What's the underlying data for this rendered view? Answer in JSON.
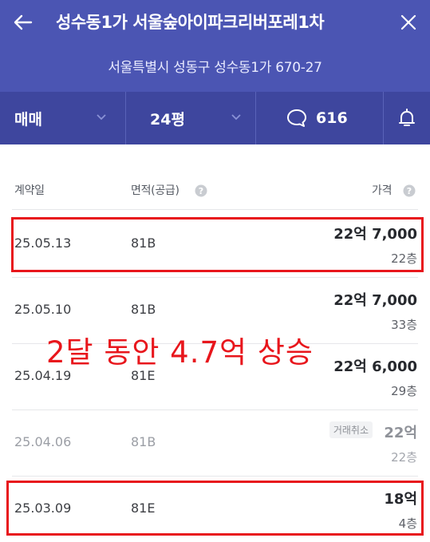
{
  "header": {
    "title": "성수동1가 서울숲아이파크리버포레1차",
    "address": "서울특별시 성동구 성수동1가 670-27",
    "icons": {
      "back": "arrow-left-icon",
      "close": "close-icon"
    },
    "bg_color": "#4b55b3"
  },
  "filters": {
    "deal_type": "매매",
    "size": "24평",
    "comment_count": "616",
    "icons": {
      "comment": "speech-bubble-icon",
      "alarm": "bell-icon"
    }
  },
  "table": {
    "columns": {
      "date": "계약일",
      "area": "면적(공급)",
      "price": "가격"
    },
    "rows": [
      {
        "date": "25.05.13",
        "area": "81B",
        "price": "22억 7,000",
        "floor": "22층",
        "cancelled": false,
        "highlighted": true
      },
      {
        "date": "25.05.10",
        "area": "81B",
        "price": "22억 7,000",
        "floor": "33층",
        "cancelled": false,
        "highlighted": false
      },
      {
        "date": "25.04.19",
        "area": "81E",
        "price": "22억 6,000",
        "floor": "29층",
        "cancelled": false,
        "highlighted": false
      },
      {
        "date": "25.04.06",
        "area": "81B",
        "price": "22억",
        "floor": "22층",
        "cancelled": true,
        "cancel_label": "거래취소",
        "highlighted": false
      },
      {
        "date": "25.03.09",
        "area": "81E",
        "price": "18억",
        "floor": "4층",
        "cancelled": false,
        "highlighted": true
      }
    ]
  },
  "annotation": {
    "text": "2달 동안 4.7억 상승",
    "color": "#e8161c"
  }
}
